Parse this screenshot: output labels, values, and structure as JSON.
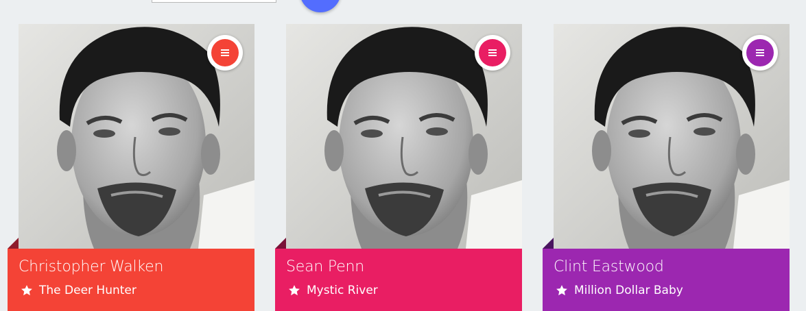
{
  "theme": {
    "background": "#eceff1",
    "fab_color": "#536dfe"
  },
  "icons": {
    "menu": "menu-icon",
    "favorite": "star-icon"
  },
  "cards": [
    {
      "name": "Christopher Walken",
      "movie": "The Deer Hunter",
      "color": "#f44336",
      "fold_color": "#8e1c2c"
    },
    {
      "name": "Sean Penn",
      "movie": "Mystic River",
      "color": "#e91e63",
      "fold_color": "#7a1238"
    },
    {
      "name": "Clint Eastwood",
      "movie": "Million Dollar Baby",
      "color": "#9c27b0",
      "fold_color": "#4a1560"
    }
  ]
}
